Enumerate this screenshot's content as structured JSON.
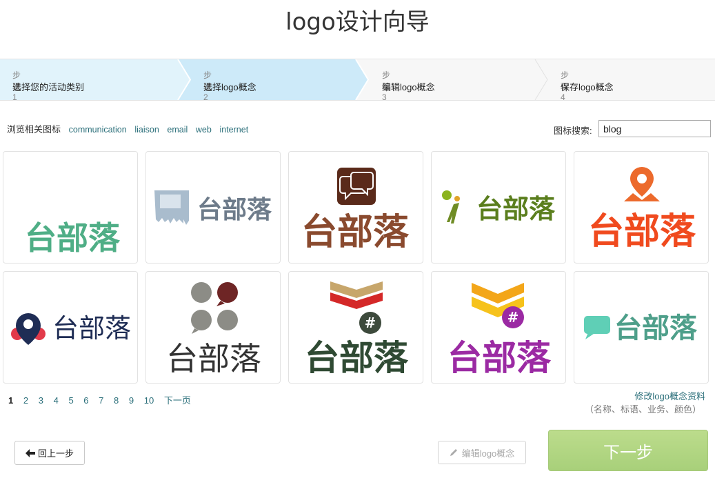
{
  "title": "logo设计向导",
  "steps": [
    {
      "num": "步骤 1",
      "label": "选择您的活动类别"
    },
    {
      "num": "步骤 2",
      "label": "选择logo概念"
    },
    {
      "num": "步骤 3",
      "label": "编辑logo概念"
    },
    {
      "num": "步骤 4",
      "label": "保存logo概念"
    }
  ],
  "browse": {
    "label": "浏览相关图标",
    "tags": [
      "communication",
      "liaison",
      "email",
      "web",
      "internet"
    ]
  },
  "search": {
    "label": "图标搜索:",
    "value": "blog"
  },
  "logo_text": "台部落",
  "pagination": {
    "pages": [
      "1",
      "2",
      "3",
      "4",
      "5",
      "6",
      "7",
      "8",
      "9",
      "10"
    ],
    "current": "1",
    "next": "下一页"
  },
  "edit_info": {
    "link": "修改logo概念资料",
    "note": "（名称、标语、业务、颜色）"
  },
  "buttons": {
    "back": "回上一步",
    "edit": "编辑logo概念",
    "next": "下一步"
  },
  "colors": {
    "step_active": "#cdeaf9",
    "step_done": "#e1f3fb",
    "link": "#2b6f7a",
    "next_button": "#b1d67f"
  }
}
